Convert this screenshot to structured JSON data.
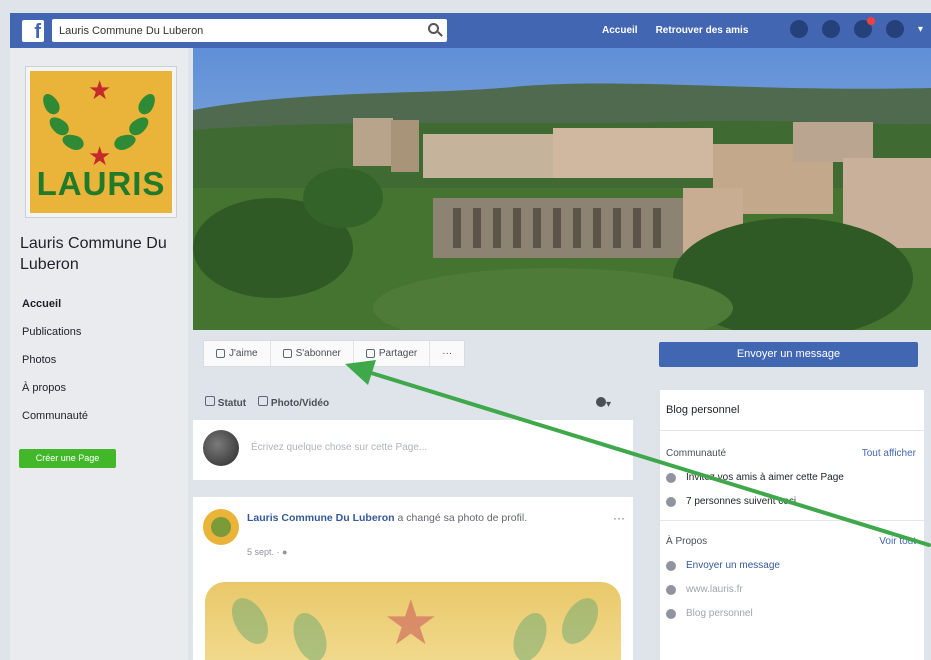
{
  "topbar": {
    "search_value": "Lauris Commune Du Luberon",
    "nav": [
      "Accueil",
      "Retrouver des amis"
    ]
  },
  "left": {
    "logo_text": "LAURIS",
    "page_name": "Lauris Commune Du Luberon",
    "nav": [
      "Accueil",
      "Publications",
      "Photos",
      "À propos",
      "Communauté"
    ],
    "create_page": "Créer une Page"
  },
  "actions": {
    "like": "J'aime",
    "follow": "S'abonner",
    "share": "Partager",
    "more": "···"
  },
  "right": {
    "message_button": "Envoyer un message",
    "title": "Blog personnel",
    "community_label": "Communauté",
    "see_all": "Tout afficher",
    "invite_text": "Invitez vos amis à aimer cette Page",
    "followers_text": "7 personnes suivent ceci",
    "about_label": "À Propos",
    "about_see_all": "Voir tout",
    "contact_message": "Envoyer un message",
    "website": "www.lauris.fr",
    "category": "Blog personnel"
  },
  "composer": {
    "tab_status": "Statut",
    "tab_photo": "Photo/Vidéo",
    "placeholder": "Écrivez quelque chose sur cette Page..."
  },
  "post": {
    "author": "Lauris Commune Du Luberon",
    "action": "a changé sa photo de profil.",
    "time": "5 sept. · ",
    "more": "···"
  },
  "colors": {
    "facebook_blue": "#4266b2",
    "create_green": "#42b72a",
    "logo_yellow": "#eab33a",
    "logo_green": "#1f7a2a",
    "arrow_green": "#3fa84a"
  }
}
